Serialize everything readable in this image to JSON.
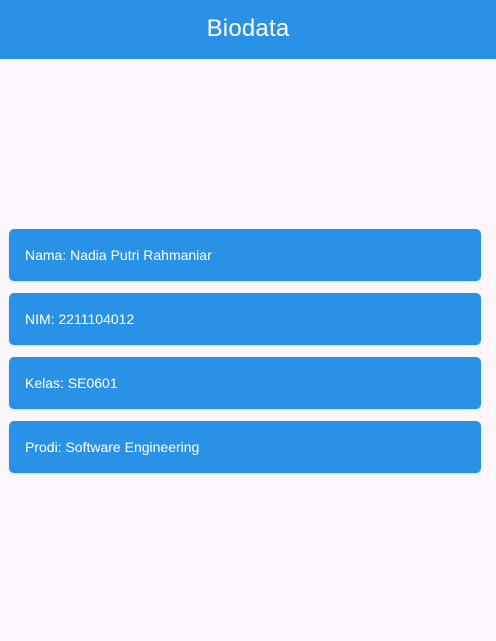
{
  "app_bar": {
    "title": "Biodata",
    "background_color": "#2A92E6"
  },
  "biodata_items": [
    {
      "text": "Nama: Nadia Putri Rahmaniar"
    },
    {
      "text": "NIM: 2211104012"
    },
    {
      "text": "Kelas: SE0601"
    },
    {
      "text": "Prodi: Software Engineering"
    }
  ],
  "colors": {
    "page_background": "#FDF7FD",
    "card_background": "#2A92E6",
    "text_on_primary": "#FFFFFF"
  }
}
